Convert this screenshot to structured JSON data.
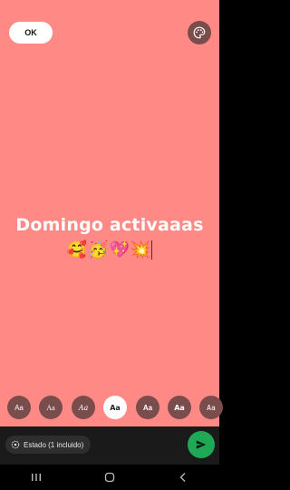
{
  "top": {
    "ok_label": "OK",
    "palette_icon": "palette-icon"
  },
  "caption": {
    "text": "Domingo activaaas",
    "emojis": [
      "🥰",
      "🥳",
      "💖",
      "💥"
    ]
  },
  "font_options": [
    "Aa",
    "Aa",
    "Aa",
    "Aa",
    "Aa",
    "Aa",
    "Aa"
  ],
  "selected_font_index": 3,
  "status": {
    "label": "Estado (1 incluido)",
    "icon": "status-icon"
  },
  "send": {
    "icon": "send-icon"
  },
  "navigation": {
    "recent_icon": "recent-apps-icon",
    "home_icon": "home-icon",
    "back_icon": "back-icon"
  },
  "colors": {
    "background": "#ff8a85",
    "send": "#1fa855",
    "chip": "#7a4d4d"
  }
}
